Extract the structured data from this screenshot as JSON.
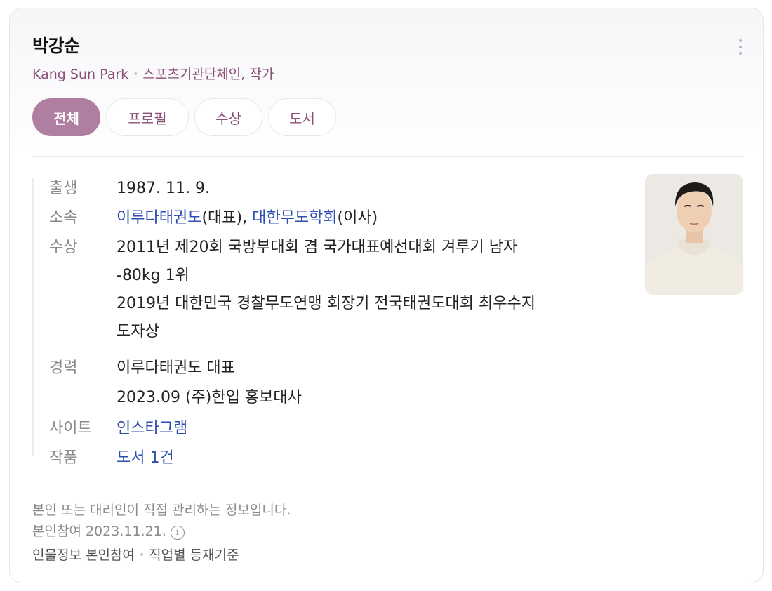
{
  "person": {
    "name": "박강순",
    "english_name": "Kang Sun Park",
    "occupation": "스포츠기관단체인, 작가"
  },
  "tabs": [
    {
      "label": "전체",
      "active": true
    },
    {
      "label": "프로필",
      "active": false
    },
    {
      "label": "수상",
      "active": false
    },
    {
      "label": "도서",
      "active": false
    }
  ],
  "info": {
    "birth": {
      "label": "출생",
      "value": "1987. 11. 9."
    },
    "affiliation": {
      "label": "소속",
      "org1": "이루다태권도",
      "org1_role": "(대표), ",
      "org2": "대한무도학회",
      "org2_role": "(이사)"
    },
    "awards": {
      "label": "수상",
      "lines": [
        "2011년 제20회 국방부대회 겸 국가대표예선대회 겨루기 남자",
        "-80kg 1위",
        "2019년 대한민국 경찰무도연맹 회장기 전국태권도대회 최우수지",
        "도자상"
      ]
    },
    "career": {
      "label": "경력",
      "lines": [
        "이루다태권도 대표",
        "2023.09 (주)한입 홍보대사"
      ]
    },
    "site": {
      "label": "사이트",
      "value": "인스타그램"
    },
    "works": {
      "label": "작품",
      "value": "도서 1건"
    }
  },
  "footer": {
    "notice": "본인 또는 대리인이 직접 관리하는 정보입니다.",
    "participation": "본인참여 2023.11.21.",
    "info_icon": "i",
    "link1": "인물정보 본인참여",
    "link2": "직업별 등재기준"
  },
  "colors": {
    "accent": "#b07ea0",
    "subtitle": "#8b4e77",
    "link": "#2f4fb0"
  },
  "icons": [
    "more-vertical-icon",
    "info-circle-icon"
  ]
}
